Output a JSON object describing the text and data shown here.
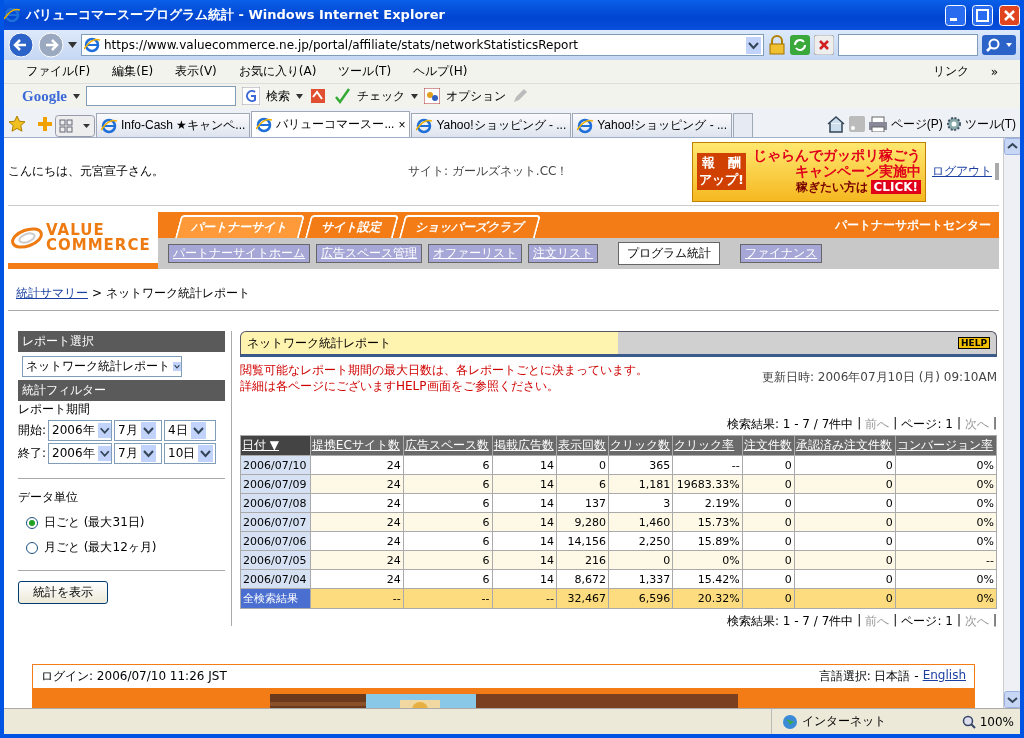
{
  "window": {
    "title": "バリューコマースープログラム統計 - Windows Internet Explorer"
  },
  "address_bar": {
    "url": "https://www.valuecommerce.ne.jp/portal/affiliate/stats/networkStatisticsReport"
  },
  "menu": [
    "ファイル(F)",
    "編集(E)",
    "表示(V)",
    "お気に入り(A)",
    "ツール(T)",
    "ヘルプ(H)"
  ],
  "links": {
    "label": "リンク",
    "more": "»"
  },
  "google_bar": {
    "brand": "Google",
    "search": "検索",
    "check": "チェック",
    "options": "オプション"
  },
  "browser_tabs": [
    {
      "label": "Info-Cash ★キャンペ...",
      "selected": false
    },
    {
      "label": "バリューコマースー...",
      "selected": true,
      "close": "×"
    },
    {
      "label": "Yahoo!ショッピング - ...",
      "selected": false
    },
    {
      "label": "Yahoo!ショッピング - ...",
      "selected": false
    }
  ],
  "command_bar": {
    "page": "ページ(P)",
    "tools": "ツール(T)"
  },
  "header": {
    "greeting": "こんにちは、元宮宣子さん。",
    "site": "サイト: ガールズネット.CC！",
    "logout": "ログアウト",
    "ad": {
      "badge": [
        "報　酬",
        "アップ!"
      ],
      "headline": [
        "じゃらんでガッポリ稼ごう",
        "キャンペーン実施中"
      ],
      "sub": "稼ぎたい方は",
      "click": "CLICK!"
    }
  },
  "nav": {
    "logo": [
      "VALUE",
      "COMMERCE"
    ],
    "support": "パートナーサポートセンター",
    "main_tabs": [
      {
        "label": "パートナーサイト",
        "selected": true
      },
      {
        "label": "サイト設定",
        "selected": false
      },
      {
        "label": "ショッパーズクラブ",
        "selected": false
      }
    ],
    "sub_tabs": [
      {
        "label": "パートナーサイトホーム",
        "selected": false
      },
      {
        "label": "広告スペース管理",
        "selected": false
      },
      {
        "label": "オファーリスト",
        "selected": false
      },
      {
        "label": "注文リスト",
        "selected": false
      },
      {
        "label": "プログラム統計",
        "selected": true
      },
      {
        "label": "ファイナンス",
        "selected": false
      }
    ]
  },
  "breadcrumb": {
    "link": "統計サマリー",
    "current": "> ネットワーク統計レポート"
  },
  "sidebar": {
    "report_heading": "レポート選択",
    "report_select": "ネットワーク統計レポート",
    "filter_heading": "統計フィルター",
    "period_label": "レポート期間",
    "start": {
      "label": "開始:",
      "year": "2006年",
      "month": "7月",
      "day": "4日"
    },
    "end": {
      "label": "終了:",
      "year": "2006年",
      "month": "7月",
      "day": "10日"
    },
    "unit_label": "データ単位",
    "units": [
      {
        "label": "日ごと (最大31日)",
        "selected": true
      },
      {
        "label": "月ごと (最大12ヶ月)",
        "selected": false
      }
    ],
    "button": "統計を表示"
  },
  "report": {
    "title": "ネットワーク統計レポート",
    "help": "HELP",
    "notice": [
      "閲覧可能なレポート期間の最大日数は、各レポートごとに決まっています。",
      "詳細は各ページにございますHELP画面をご参照ください。"
    ],
    "updated": "更新日時: 2006年07月10日 (月) 09:10AM",
    "pagination_top": [
      {
        "text": "検索結果: 1 - 7 / 7件中",
        "disabled": false
      },
      {
        "text": "|",
        "disabled": false
      },
      {
        "text": "前へ",
        "disabled": true
      },
      {
        "text": "|",
        "disabled": false
      },
      {
        "text": "ページ: 1",
        "disabled": false
      },
      {
        "text": "|",
        "disabled": false
      },
      {
        "text": "次へ",
        "disabled": true
      },
      {
        "text": "|",
        "disabled": false
      }
    ],
    "pagination_bottom": [
      {
        "text": "検索結果: 1 - 7 / 7件中",
        "disabled": false
      },
      {
        "text": "|",
        "disabled": false
      },
      {
        "text": "前へ",
        "disabled": true
      },
      {
        "text": "|",
        "disabled": false
      },
      {
        "text": "ページ: 1",
        "disabled": false
      },
      {
        "text": "|",
        "disabled": false
      },
      {
        "text": "次へ",
        "disabled": true
      },
      {
        "text": "|",
        "disabled": false
      }
    ],
    "table": {
      "columns": [
        {
          "label": "日付",
          "sort": "▼"
        },
        {
          "label": "提携ECサイト数"
        },
        {
          "label": "広告スペース数"
        },
        {
          "label": "掲載広告数"
        },
        {
          "label": "表示回数"
        },
        {
          "label": "クリック数"
        },
        {
          "label": "クリック率"
        },
        {
          "label": "注文件数"
        },
        {
          "label": "承認済み注文件数"
        },
        {
          "label": "コンバージョン率"
        }
      ],
      "rows": [
        [
          "2006/07/10",
          "24",
          "6",
          "14",
          "0",
          "365",
          "--",
          "0",
          "0",
          "0%"
        ],
        [
          "2006/07/09",
          "24",
          "6",
          "14",
          "6",
          "1,181",
          "19683.33%",
          "0",
          "0",
          "0%"
        ],
        [
          "2006/07/08",
          "24",
          "6",
          "14",
          "137",
          "3",
          "2.19%",
          "0",
          "0",
          "0%"
        ],
        [
          "2006/07/07",
          "24",
          "6",
          "14",
          "9,280",
          "1,460",
          "15.73%",
          "0",
          "0",
          "0%"
        ],
        [
          "2006/07/06",
          "24",
          "6",
          "14",
          "14,156",
          "2,250",
          "15.89%",
          "0",
          "0",
          "0%"
        ],
        [
          "2006/07/05",
          "24",
          "6",
          "14",
          "216",
          "0",
          "0%",
          "0",
          "0",
          "--"
        ],
        [
          "2006/07/04",
          "24",
          "6",
          "14",
          "8,672",
          "1,337",
          "15.42%",
          "0",
          "0",
          "0%"
        ]
      ],
      "total": [
        "全検索結果",
        "--",
        "--",
        "--",
        "32,467",
        "6,596",
        "20.32%",
        "0",
        "0",
        "0%"
      ]
    }
  },
  "footer": {
    "login": "ログイン: 2006/07/10 11:26 JST",
    "language": "言語選択: 日本語 -",
    "english": "English"
  },
  "status_bar": {
    "zone": "インターネット",
    "zoom": "100%"
  }
}
